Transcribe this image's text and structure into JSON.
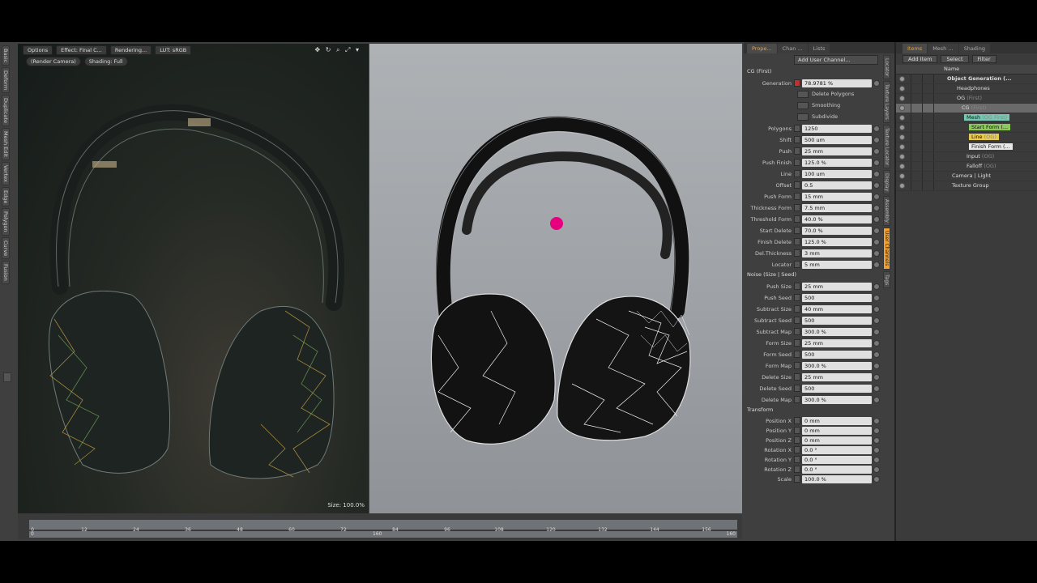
{
  "left_tabs": [
    "Basic",
    "Deform",
    "Duplicate",
    "Mesh Edit",
    "Vertex",
    "Edge",
    "Polygon",
    "Curve",
    "Fusion"
  ],
  "viewport": {
    "options": "Options",
    "effect": "Effect: Final C...",
    "rendering": "Rendering...",
    "lut": "LUT: sRGB",
    "camera": "(Render Camera)",
    "shading": "Shading: Full",
    "icons": "✥ ↻ ⌕ ⤢ ▾",
    "size": "Size: 100.0%"
  },
  "timeline": {
    "ticks": [
      "0",
      "12",
      "24",
      "36",
      "48",
      "60",
      "72",
      "84",
      "96",
      "108",
      "120",
      "132",
      "144",
      "156"
    ],
    "start": "0",
    "mid": "160",
    "end": "160"
  },
  "properties": {
    "tabs": [
      "Prope...",
      "Chan ...",
      "Lists"
    ],
    "add_channel": "Add User Channel...",
    "side_tabs": [
      "Locator",
      "Texture Layers",
      "Texture Locator",
      "Display",
      "Assembly",
      "User Channels",
      "Tags"
    ],
    "section_cg": "CG (First)",
    "generation": {
      "label": "Generation",
      "value": "78.9781 %"
    },
    "checks": [
      "Delete Polygons",
      "Smoothing",
      "Subdivide"
    ],
    "rows": [
      {
        "label": "Polygons",
        "value": "1250"
      },
      {
        "label": "Shift",
        "value": "500 um"
      },
      {
        "label": "Push",
        "value": "25 mm"
      },
      {
        "label": "Push Finish",
        "value": "125.0 %"
      },
      {
        "label": "Line",
        "value": "100 um"
      },
      {
        "label": "Offset",
        "value": "0.5"
      },
      {
        "label": "Push Form",
        "value": "15 mm"
      },
      {
        "label": "Thickness Form",
        "value": "7.5 mm"
      },
      {
        "label": "Threshold Form",
        "value": "40.0 %"
      },
      {
        "label": "Start Delete",
        "value": "70.0 %"
      },
      {
        "label": "Finish Delete",
        "value": "125.0 %"
      },
      {
        "label": "Del.Thickness",
        "value": "3 mm"
      },
      {
        "label": "Locator",
        "value": "5 mm"
      }
    ],
    "section_noise": "Noise (Size | Seed)",
    "noise_rows": [
      {
        "label": "Push Size",
        "value": "25 mm"
      },
      {
        "label": "Push Seed",
        "value": "500"
      },
      {
        "label": "Subtract Size",
        "value": "40 mm"
      },
      {
        "label": "Subtract Seed",
        "value": "500"
      },
      {
        "label": "Subtract Map",
        "value": "300.0 %"
      },
      {
        "label": "Form Size",
        "value": "25 mm"
      },
      {
        "label": "Form Seed",
        "value": "500"
      },
      {
        "label": "Form Map",
        "value": "300.0 %"
      },
      {
        "label": "Delete Size",
        "value": "25 mm"
      },
      {
        "label": "Delete Seed",
        "value": "500"
      },
      {
        "label": "Delete Map",
        "value": "300.0 %"
      }
    ],
    "section_transform": "Transform",
    "transform_rows": [
      {
        "label": "Position X",
        "value": "0 mm"
      },
      {
        "label": "Position Y",
        "value": "0 mm"
      },
      {
        "label": "Position Z",
        "value": "0 mm"
      },
      {
        "label": "Rotation X",
        "value": "0.0 °"
      },
      {
        "label": "Rotation Y",
        "value": "0.0 °"
      },
      {
        "label": "Rotation Z",
        "value": "0.0 °"
      },
      {
        "label": "Scale",
        "value": "100.0 %"
      }
    ]
  },
  "items": {
    "tabs": [
      "Items",
      "Mesh ...",
      "Shading"
    ],
    "add_item": "Add Item",
    "select": "Select",
    "filter": "Filter",
    "name_header": "Name",
    "tree": [
      {
        "name": "Object Generation (...",
        "style": "ibold"
      },
      {
        "name": "Headphones",
        "style": ""
      },
      {
        "name": "OG",
        "suffix": "(First)",
        "style": ""
      },
      {
        "name": "CG",
        "suffix": "(First)",
        "style": "sel"
      },
      {
        "name": "Mesh",
        "suffix": "(OG First)",
        "style": "hl-teal"
      },
      {
        "name": "Start Form (...",
        "style": "hl-green"
      },
      {
        "name": "Line",
        "suffix": "(OG)",
        "style": "hl-yellow"
      },
      {
        "name": "Finish Form (...",
        "style": "hl-white"
      },
      {
        "name": "Input",
        "suffix": "(OG)",
        "style": ""
      },
      {
        "name": "Falloff",
        "suffix": "(OG)",
        "style": ""
      },
      {
        "name": "Camera | Light",
        "style": ""
      },
      {
        "name": "Texture Group",
        "style": ""
      }
    ]
  }
}
